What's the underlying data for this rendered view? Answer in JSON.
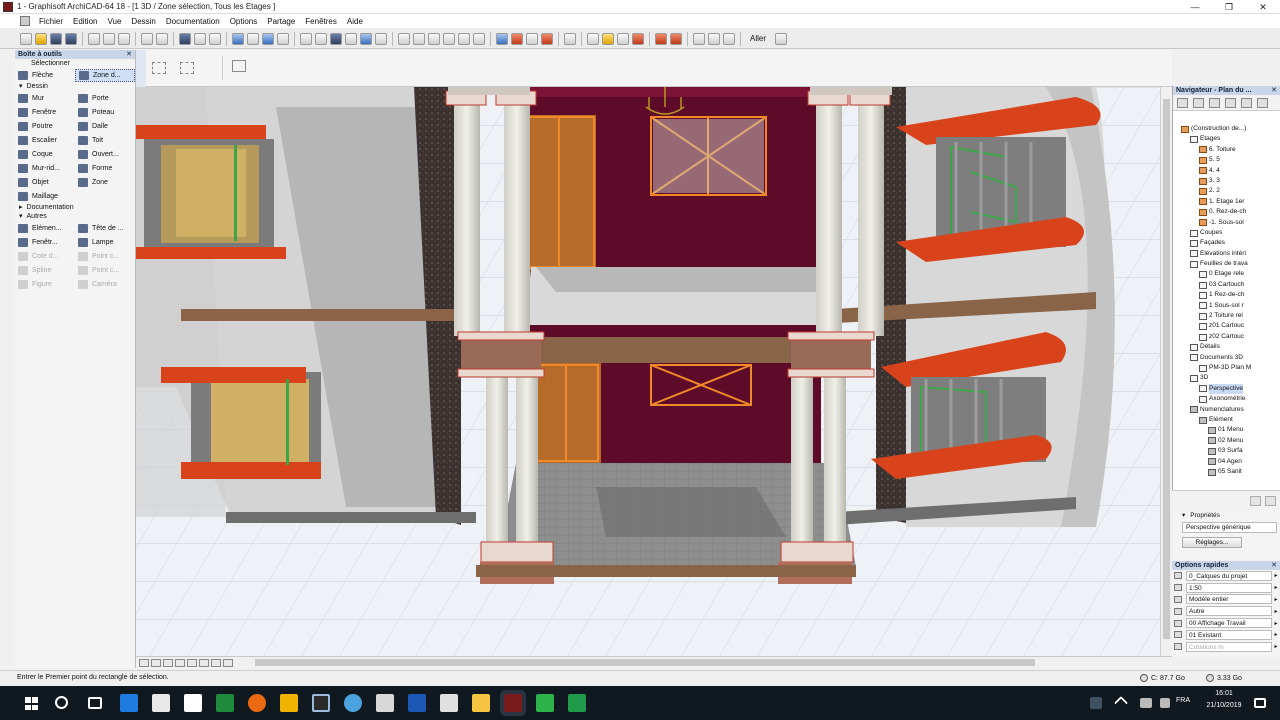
{
  "window": {
    "title": "1 - Graphisoft ArchiCAD-64 18 - [1 3D / Zone sélection, Tous les Etages ]",
    "controls": [
      "—",
      "❐",
      "✕"
    ]
  },
  "menu": [
    "Fichier",
    "Edition",
    "Vue",
    "Dessin",
    "Documentation",
    "Options",
    "Partage",
    "Fenêtres",
    "Aide"
  ],
  "toolbar": {
    "go_label": "Aller"
  },
  "toolbox": {
    "title": "Boîte à outils",
    "select_label": "Sélectionner",
    "select_tools": [
      "Flèche",
      "Zone d..."
    ],
    "section_dessin": "Dessin",
    "dessin_tools": [
      [
        "Mur",
        "Porte"
      ],
      [
        "Fenêtre",
        "Poteau"
      ],
      [
        "Poutre",
        "Dalle"
      ],
      [
        "Escalier",
        "Toit"
      ],
      [
        "Coque",
        "Ouvert..."
      ],
      [
        "Mur-rid...",
        "Forme"
      ],
      [
        "Objet",
        "Zone"
      ],
      [
        "Maillage",
        ""
      ]
    ],
    "section_documentation": "Documentation",
    "section_autres": "Autres",
    "autres_tools": [
      [
        "Elémen...",
        "Tête de ..."
      ],
      [
        "Fenêtr...",
        "Lampe"
      ],
      [
        "Cote d...",
        "Point c..."
      ],
      [
        "Spline",
        "Point c..."
      ],
      [
        "Figure",
        "Caméra"
      ]
    ]
  },
  "navigator": {
    "title": "Navigateur - Plan du ...",
    "tree": [
      {
        "label": "(Construction de...)",
        "level": 0,
        "icon": "storey"
      },
      {
        "label": "Etages",
        "level": 1,
        "icon": "sheet"
      },
      {
        "label": "6. Toiture",
        "level": 2,
        "icon": "storey"
      },
      {
        "label": "5. 5",
        "level": 2,
        "icon": "storey"
      },
      {
        "label": "4. 4",
        "level": 2,
        "icon": "storey"
      },
      {
        "label": "3. 3",
        "level": 2,
        "icon": "storey"
      },
      {
        "label": "2. 2",
        "level": 2,
        "icon": "storey"
      },
      {
        "label": "1. Etage 1er",
        "level": 2,
        "icon": "storey"
      },
      {
        "label": "0. Rez-de-ch",
        "level": 2,
        "icon": "storey"
      },
      {
        "label": "-1. Sous-sol",
        "level": 2,
        "icon": "storey"
      },
      {
        "label": "Coupes",
        "level": 1,
        "icon": "sheet"
      },
      {
        "label": "Façades",
        "level": 1,
        "icon": "sheet"
      },
      {
        "label": "Elévations intéri",
        "level": 1,
        "icon": "sheet"
      },
      {
        "label": "Feuilles de trava",
        "level": 1,
        "icon": "sheet"
      },
      {
        "label": "0 Etage rele",
        "level": 2,
        "icon": "sheet"
      },
      {
        "label": "03 Cartouch",
        "level": 2,
        "icon": "sheet"
      },
      {
        "label": "1 Rez-de-ch",
        "level": 2,
        "icon": "sheet"
      },
      {
        "label": "1 Sous-sol r",
        "level": 2,
        "icon": "sheet"
      },
      {
        "label": "2 Toiture rel",
        "level": 2,
        "icon": "sheet"
      },
      {
        "label": "z01 Cartouc",
        "level": 2,
        "icon": "sheet"
      },
      {
        "label": "z02 Cartouc",
        "level": 2,
        "icon": "sheet"
      },
      {
        "label": "Détails",
        "level": 1,
        "icon": "sheet"
      },
      {
        "label": "Documents 3D",
        "level": 1,
        "icon": "sheet"
      },
      {
        "label": "PM-3D Plan M",
        "level": 2,
        "icon": "sheet"
      },
      {
        "label": "3D",
        "level": 1,
        "icon": "sheet"
      },
      {
        "label": "Perspective",
        "level": 2,
        "icon": "sheet",
        "selected": true
      },
      {
        "label": "Axonométrie",
        "level": 2,
        "icon": "sheet"
      },
      {
        "label": "Nomenclatures",
        "level": 1,
        "icon": "list"
      },
      {
        "label": "Elément",
        "level": 2,
        "icon": "list"
      },
      {
        "label": "01 Menu",
        "level": 3,
        "icon": "list"
      },
      {
        "label": "02 Menu",
        "level": 3,
        "icon": "list"
      },
      {
        "label": "03 Surfa",
        "level": 3,
        "icon": "list"
      },
      {
        "label": "04 Agen",
        "level": 3,
        "icon": "list"
      },
      {
        "label": "05 Sanit",
        "level": 3,
        "icon": "list"
      }
    ]
  },
  "properties": {
    "title": "Propriétés",
    "field": "Perspective générique",
    "button": "Réglages..."
  },
  "quick_options": {
    "title": "Options rapides",
    "rows": [
      {
        "value": "0_Calques du projet",
        "dim": false
      },
      {
        "value": "1:50",
        "dim": false
      },
      {
        "value": "Modèle entier",
        "dim": false
      },
      {
        "value": "Autre",
        "dim": false
      },
      {
        "value": "00 Affichage Travail",
        "dim": false
      },
      {
        "value": "01 Existant",
        "dim": false
      },
      {
        "value": "Cotations m",
        "dim": true
      }
    ]
  },
  "status": {
    "message": "Entrer le Premier point du rectangle de sélection.",
    "disk_c": "C: 87.7 Go",
    "memory": "3.33 Go"
  },
  "taskbar": {
    "language": "FRA",
    "time": "16:01",
    "date": "21/10/2019"
  },
  "colors": {
    "accent_balcony": "#e0461e",
    "window_frame": "#f08a28",
    "rear_wall": "#5e0b2a",
    "column": "#e2e2da"
  }
}
